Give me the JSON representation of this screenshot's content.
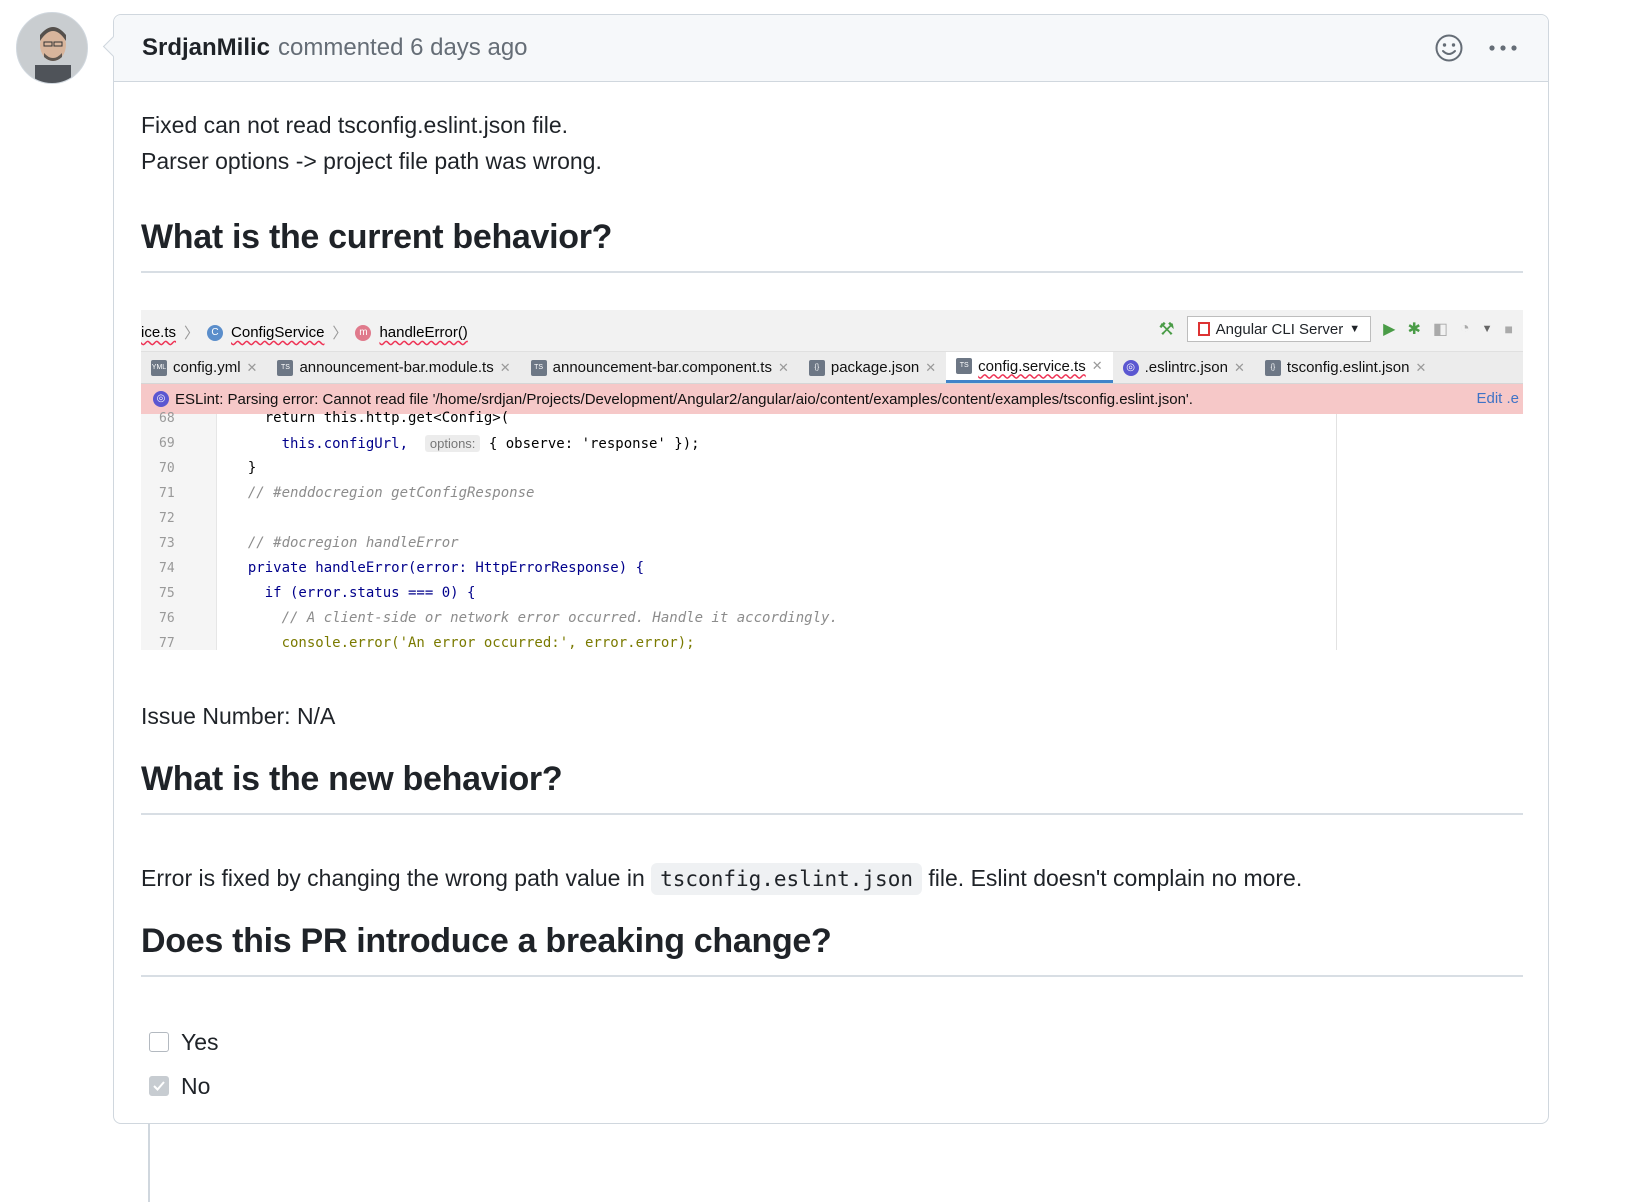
{
  "comment": {
    "author": "SrdjanMilic",
    "meta": "commented 6 days ago",
    "intro_lines": [
      "Fixed can not read tsconfig.eslint.json file.",
      "Parser options -> project file path was wrong."
    ],
    "h_current": "What is the current behavior?",
    "issue_number": "Issue Number: N/A",
    "h_new": "What is the new behavior?",
    "new_text_before": "Error is fixed by changing the wrong path value in",
    "new_code": "tsconfig.eslint.json",
    "new_text_after": "file. Eslint doesn't complain no more.",
    "h_breaking": "Does this PR introduce a breaking change?",
    "options": [
      {
        "label": "Yes",
        "checked": false
      },
      {
        "label": "No",
        "checked": true
      }
    ]
  },
  "ide": {
    "breadcrumbs": [
      "ice.ts",
      "ConfigService",
      "handleError()"
    ],
    "run_config": "Angular CLI Server",
    "tabs": [
      "config.yml",
      "announcement-bar.module.ts",
      "announcement-bar.component.ts",
      "package.json",
      "config.service.ts",
      ".eslintrc.json",
      "tsconfig.eslint.json"
    ],
    "active_tab": "config.service.ts",
    "error": "ESLint: Parsing error: Cannot read file '/home/srdjan/Projects/Development/Angular2/angular/aio/content/examples/content/examples/tsconfig.eslint.json'.",
    "edit_link": "Edit .e",
    "line_numbers": [
      "68",
      "69",
      "70",
      "71",
      "72",
      "73",
      "74",
      "75",
      "76",
      "77"
    ],
    "code_lines": [
      "    return this.http.get<Config>(",
      "      this.configUrl, ",
      "  }",
      "  // #enddocregion getConfigResponse",
      "",
      "  // #docregion handleError",
      "  private handleError(error: HttpErrorResponse) {",
      "    if (error.status === 0) {",
      "      // A client-side or network error occurred. Handle it accordingly.",
      "      console.error('An error occurred:', error.error);"
    ],
    "hint_label": "options:",
    "hint_tail": "{ observe: 'response' });"
  },
  "colors": {
    "border": "#d0d7de",
    "header_bg": "#f6f8fa",
    "error_banner": "#f6c8c8",
    "active_tab_underline": "#4083c9"
  }
}
